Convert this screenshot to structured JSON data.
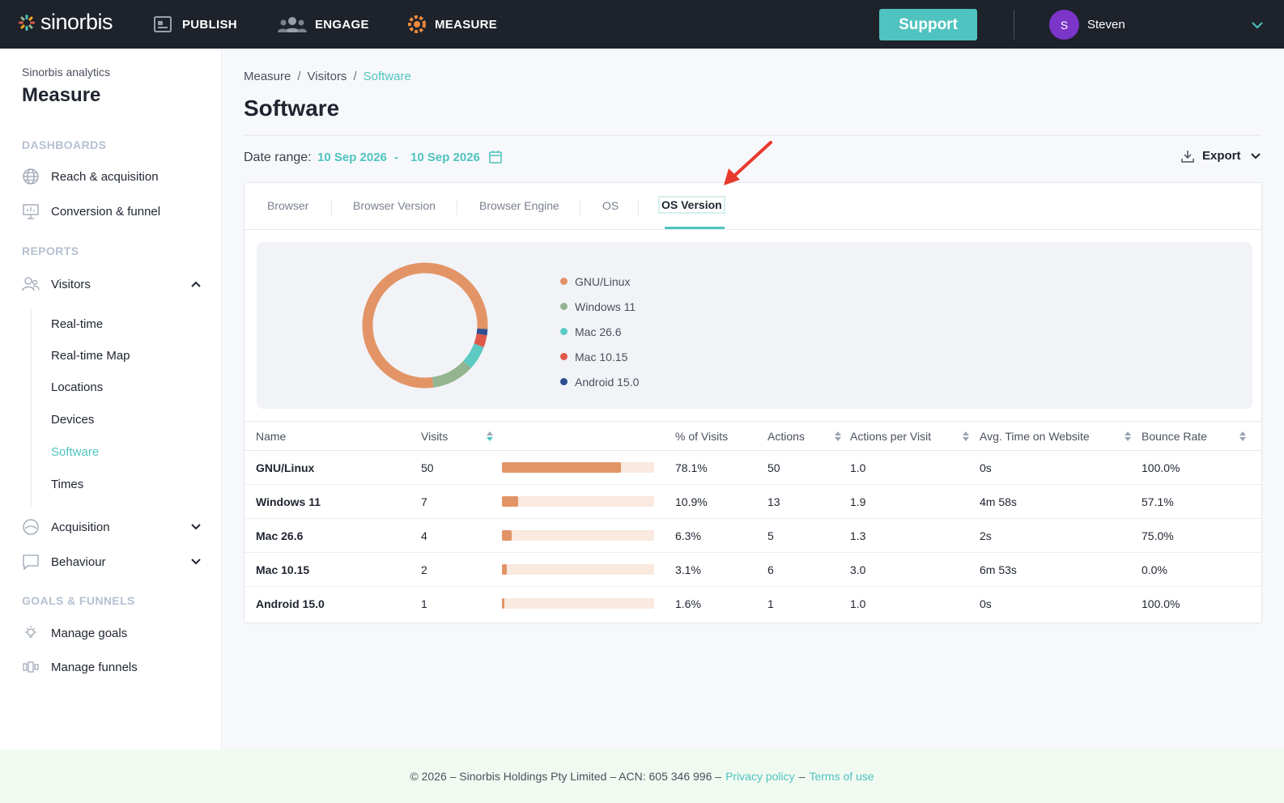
{
  "brand": {
    "name": "sinorbis"
  },
  "topnav": [
    {
      "label": "PUBLISH",
      "icon": "publish-icon"
    },
    {
      "label": "ENGAGE",
      "icon": "engage-icon"
    },
    {
      "label": "MEASURE",
      "icon": "measure-icon"
    }
  ],
  "support_label": "Support",
  "user": {
    "initial": "S",
    "name": "Steven"
  },
  "sidebar": {
    "subtitle": "Sinorbis analytics",
    "title": "Measure",
    "sections": {
      "dashboards": "DASHBOARDS",
      "reports": "REPORTS",
      "goals": "GOALS & FUNNELS"
    },
    "dashboards": [
      "Reach & acquisition",
      "Conversion & funnel"
    ],
    "visitors": "Visitors",
    "visitor_items": [
      "Real-time",
      "Real-time Map",
      "Locations",
      "Devices",
      "Software",
      "Times"
    ],
    "acquisition": "Acquisition",
    "behaviour": "Behaviour",
    "goals_items": [
      "Manage goals",
      "Manage funnels"
    ]
  },
  "breadcrumb": [
    "Measure",
    "Visitors",
    "Software"
  ],
  "breadcrumb_sep": "/",
  "page_title": "Software",
  "date_range": {
    "label": "Date range:",
    "from": "10 Sep 2026",
    "dash": "-",
    "to": "10 Sep 2026"
  },
  "export_label": "Export",
  "tabs": [
    "Browser",
    "Browser Version",
    "Browser Engine",
    "OS",
    "OS Version"
  ],
  "active_tab": "OS Version",
  "chart_data": {
    "type": "pie",
    "categories": [
      "GNU/Linux",
      "Windows 11",
      "Mac 26.6",
      "Mac 10.15",
      "Android 15.0"
    ],
    "values": [
      50,
      7,
      4,
      2,
      1
    ],
    "colors": [
      "#e39466",
      "#93b48e",
      "#5cc9c3",
      "#e0584a",
      "#2e4f93"
    ],
    "legend": "right"
  },
  "table": {
    "headers": [
      "Name",
      "Visits",
      "% of Visits",
      "Actions",
      "Actions per Visit",
      "Avg. Time on Website",
      "Bounce Rate"
    ],
    "rows": [
      {
        "name": "GNU/Linux",
        "visits": "50",
        "pct": "78.1%",
        "fraction": 0.781,
        "actions": "50",
        "apv": "1.0",
        "avg_time": "0s",
        "bounce": "100.0%"
      },
      {
        "name": "Windows 11",
        "visits": "7",
        "pct": "10.9%",
        "fraction": 0.109,
        "actions": "13",
        "apv": "1.9",
        "avg_time": "4m 58s",
        "bounce": "57.1%"
      },
      {
        "name": "Mac 26.6",
        "visits": "4",
        "pct": "6.3%",
        "fraction": 0.063,
        "actions": "5",
        "apv": "1.3",
        "avg_time": "2s",
        "bounce": "75.0%"
      },
      {
        "name": "Mac 10.15",
        "visits": "2",
        "pct": "3.1%",
        "fraction": 0.031,
        "actions": "6",
        "apv": "3.0",
        "avg_time": "6m 53s",
        "bounce": "0.0%"
      },
      {
        "name": "Android 15.0",
        "visits": "1",
        "pct": "1.6%",
        "fraction": 0.016,
        "actions": "1",
        "apv": "1.0",
        "avg_time": "0s",
        "bounce": "100.0%"
      }
    ]
  },
  "footer": {
    "text": "© 2026 – Sinorbis Holdings Pty Limited – ACN: 605 346 996 –",
    "privacy": "Privacy policy",
    "dash": "–",
    "terms": "Terms of use"
  },
  "colors": {
    "accent": "#4fc3bf",
    "topbar": "#1d222b",
    "bar": "#e39466",
    "bar_track": "#f9e9df",
    "annotation_arrow": "#e8392d"
  }
}
